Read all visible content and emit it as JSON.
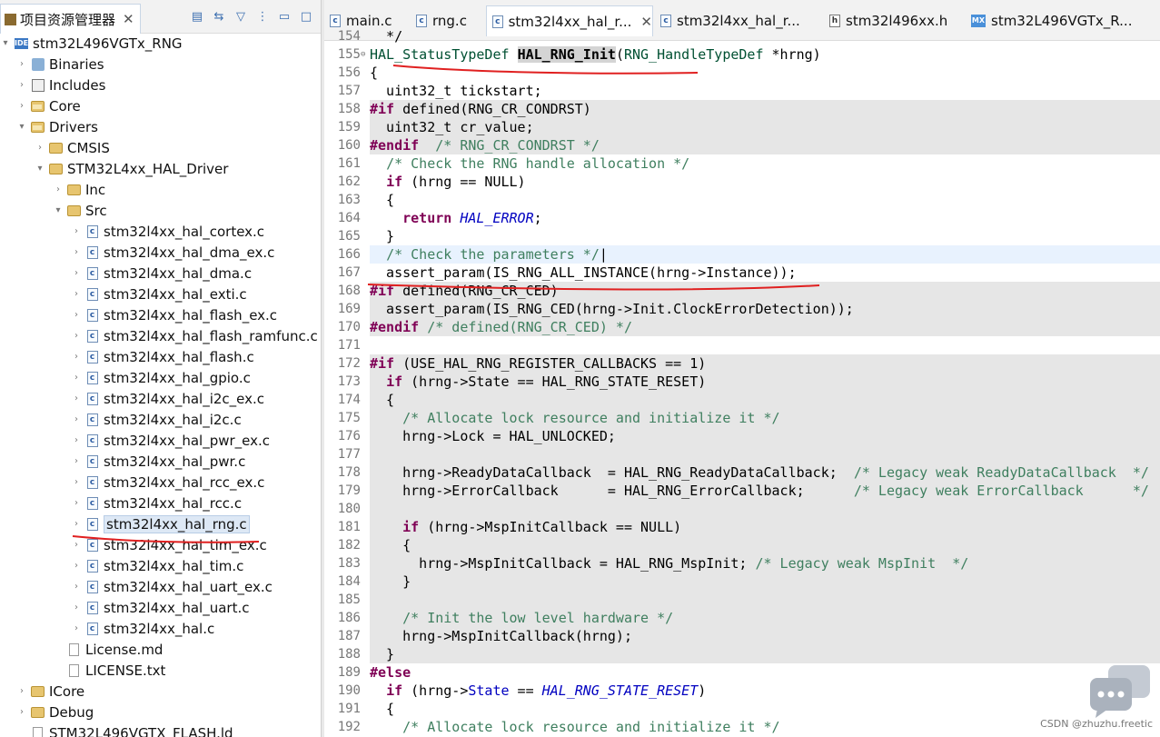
{
  "left_panel": {
    "tab_label": "项目资源管理器",
    "tab_close": "✕",
    "tree": [
      {
        "label": "stm32L496VGTx_RNG",
        "indent": 0,
        "arrow": "▾",
        "icon": "project"
      },
      {
        "label": "Binaries",
        "indent": 1,
        "arrow": "›",
        "icon": "binaries"
      },
      {
        "label": "Includes",
        "indent": 1,
        "arrow": "›",
        "icon": "includes"
      },
      {
        "label": "Core",
        "indent": 1,
        "arrow": "›",
        "icon": "src-folder"
      },
      {
        "label": "Drivers",
        "indent": 1,
        "arrow": "▾",
        "icon": "src-folder"
      },
      {
        "label": "CMSIS",
        "indent": 2,
        "arrow": "›",
        "icon": "folder"
      },
      {
        "label": "STM32L4xx_HAL_Driver",
        "indent": 2,
        "arrow": "▾",
        "icon": "folder"
      },
      {
        "label": "Inc",
        "indent": 3,
        "arrow": "›",
        "icon": "folder"
      },
      {
        "label": "Src",
        "indent": 3,
        "arrow": "▾",
        "icon": "folder"
      },
      {
        "label": "stm32l4xx_hal_cortex.c",
        "indent": 4,
        "arrow": "›",
        "icon": "c"
      },
      {
        "label": "stm32l4xx_hal_dma_ex.c",
        "indent": 4,
        "arrow": "›",
        "icon": "c"
      },
      {
        "label": "stm32l4xx_hal_dma.c",
        "indent": 4,
        "arrow": "›",
        "icon": "c"
      },
      {
        "label": "stm32l4xx_hal_exti.c",
        "indent": 4,
        "arrow": "›",
        "icon": "c"
      },
      {
        "label": "stm32l4xx_hal_flash_ex.c",
        "indent": 4,
        "arrow": "›",
        "icon": "c"
      },
      {
        "label": "stm32l4xx_hal_flash_ramfunc.c",
        "indent": 4,
        "arrow": "›",
        "icon": "c"
      },
      {
        "label": "stm32l4xx_hal_flash.c",
        "indent": 4,
        "arrow": "›",
        "icon": "c"
      },
      {
        "label": "stm32l4xx_hal_gpio.c",
        "indent": 4,
        "arrow": "›",
        "icon": "c"
      },
      {
        "label": "stm32l4xx_hal_i2c_ex.c",
        "indent": 4,
        "arrow": "›",
        "icon": "c"
      },
      {
        "label": "stm32l4xx_hal_i2c.c",
        "indent": 4,
        "arrow": "›",
        "icon": "c"
      },
      {
        "label": "stm32l4xx_hal_pwr_ex.c",
        "indent": 4,
        "arrow": "›",
        "icon": "c"
      },
      {
        "label": "stm32l4xx_hal_pwr.c",
        "indent": 4,
        "arrow": "›",
        "icon": "c"
      },
      {
        "label": "stm32l4xx_hal_rcc_ex.c",
        "indent": 4,
        "arrow": "›",
        "icon": "c"
      },
      {
        "label": "stm32l4xx_hal_rcc.c",
        "indent": 4,
        "arrow": "›",
        "icon": "c"
      },
      {
        "label": "stm32l4xx_hal_rng.c",
        "indent": 4,
        "arrow": "›",
        "icon": "c",
        "selected": true
      },
      {
        "label": "stm32l4xx_hal_tim_ex.c",
        "indent": 4,
        "arrow": "›",
        "icon": "c"
      },
      {
        "label": "stm32l4xx_hal_tim.c",
        "indent": 4,
        "arrow": "›",
        "icon": "c"
      },
      {
        "label": "stm32l4xx_hal_uart_ex.c",
        "indent": 4,
        "arrow": "›",
        "icon": "c"
      },
      {
        "label": "stm32l4xx_hal_uart.c",
        "indent": 4,
        "arrow": "›",
        "icon": "c"
      },
      {
        "label": "stm32l4xx_hal.c",
        "indent": 4,
        "arrow": "›",
        "icon": "c"
      },
      {
        "label": "License.md",
        "indent": 3,
        "arrow": "",
        "icon": "text"
      },
      {
        "label": "LICENSE.txt",
        "indent": 3,
        "arrow": "",
        "icon": "text"
      },
      {
        "label": "ICore",
        "indent": 1,
        "arrow": "›",
        "icon": "folder"
      },
      {
        "label": "Debug",
        "indent": 1,
        "arrow": "›",
        "icon": "folder"
      },
      {
        "label": "STM32L496VGTX_FLASH.ld",
        "indent": 1,
        "arrow": "",
        "icon": "text"
      }
    ]
  },
  "editor": {
    "tabs": [
      {
        "label": "main.c",
        "icon": "c"
      },
      {
        "label": "rng.c",
        "icon": "c"
      },
      {
        "label": "stm32l4xx_hal_r...",
        "icon": "c",
        "active": true
      },
      {
        "label": "stm32l4xx_hal_r...",
        "icon": "c"
      },
      {
        "label": "stm32l496xx.h",
        "icon": "h"
      },
      {
        "label": "stm32L496VGTx_R...",
        "icon": "mx"
      }
    ],
    "lines": [
      {
        "n": "154",
        "html": "  */"
      },
      {
        "n": "155",
        "fold": "⊖",
        "html": "<span class='ty'>HAL_StatusTypeDef</span> <span class='fn-hl'>HAL_RNG_Init</span>(<span class='ty'>RNG_HandleTypeDef</span> *hrng)"
      },
      {
        "n": "156",
        "html": "{"
      },
      {
        "n": "157",
        "html": "  uint32_t tickstart;"
      },
      {
        "n": "158",
        "bg": "gray",
        "html": "<span class='pp'>#if</span> defined(RNG_CR_CONDRST)"
      },
      {
        "n": "159",
        "bg": "gray",
        "html": "  uint32_t cr_value;"
      },
      {
        "n": "160",
        "bg": "gray",
        "html": "<span class='pp'>#endif</span>  <span class='cm'>/* RNG_CR_CONDRST */</span>"
      },
      {
        "n": "161",
        "html": "  <span class='cm'>/* Check the RNG handle allocation */</span>"
      },
      {
        "n": "162",
        "html": "  <span class='kw'>if</span> (hrng == NULL)"
      },
      {
        "n": "163",
        "html": "  {"
      },
      {
        "n": "164",
        "html": "    <span class='kw'>return</span> <span class='mc'>HAL_ERROR</span>;"
      },
      {
        "n": "165",
        "html": "  }"
      },
      {
        "n": "166",
        "bg": "cur",
        "html": "  <span class='cm'>/* Check the parameters */</span>|"
      },
      {
        "n": "167",
        "html": "  assert_param(IS_RNG_ALL_INSTANCE(hrng->Instance));"
      },
      {
        "n": "168",
        "bg": "gray",
        "html": "<span class='pp'>#if</span> defined(RNG_CR_CED)"
      },
      {
        "n": "169",
        "bg": "gray",
        "html": "  assert_param(IS_RNG_CED(hrng->Init.ClockErrorDetection));"
      },
      {
        "n": "170",
        "bg": "gray",
        "html": "<span class='pp'>#endif</span> <span class='cm'>/* defined(RNG_CR_CED) */</span>"
      },
      {
        "n": "171",
        "html": ""
      },
      {
        "n": "172",
        "bg": "gray",
        "html": "<span class='pp'>#if</span> (USE_HAL_RNG_REGISTER_CALLBACKS == 1)"
      },
      {
        "n": "173",
        "bg": "gray",
        "html": "  <span class='kw'>if</span> (hrng->State == HAL_RNG_STATE_RESET)"
      },
      {
        "n": "174",
        "bg": "gray",
        "html": "  {"
      },
      {
        "n": "175",
        "bg": "gray",
        "html": "    <span class='cm'>/* Allocate lock resource and initialize it */</span>"
      },
      {
        "n": "176",
        "bg": "gray",
        "html": "    hrng->Lock = HAL_UNLOCKED;"
      },
      {
        "n": "177",
        "bg": "gray",
        "html": ""
      },
      {
        "n": "178",
        "bg": "gray",
        "html": "    hrng->ReadyDataCallback  = HAL_RNG_ReadyDataCallback;  <span class='cm'>/* Legacy weak ReadyDataCallback  */</span>"
      },
      {
        "n": "179",
        "bg": "gray",
        "html": "    hrng->ErrorCallback      = HAL_RNG_ErrorCallback;      <span class='cm'>/* Legacy weak ErrorCallback      */</span>"
      },
      {
        "n": "180",
        "bg": "gray",
        "html": ""
      },
      {
        "n": "181",
        "bg": "gray",
        "html": "    <span class='kw'>if</span> (hrng->MspInitCallback == NULL)"
      },
      {
        "n": "182",
        "bg": "gray",
        "html": "    {"
      },
      {
        "n": "183",
        "bg": "gray",
        "html": "      hrng->MspInitCallback = HAL_RNG_MspInit; <span class='cm'>/* Legacy weak MspInit  */</span>"
      },
      {
        "n": "184",
        "bg": "gray",
        "html": "    }"
      },
      {
        "n": "185",
        "bg": "gray",
        "html": ""
      },
      {
        "n": "186",
        "bg": "gray",
        "html": "    <span class='cm'>/* Init the low level hardware */</span>"
      },
      {
        "n": "187",
        "bg": "gray",
        "html": "    hrng->MspInitCallback(hrng);"
      },
      {
        "n": "188",
        "bg": "gray",
        "html": "  }"
      },
      {
        "n": "189",
        "html": "<span class='pp'>#else</span>"
      },
      {
        "n": "190",
        "html": "  <span class='kw'>if</span> (hrng-><span class='fld'>State</span> == <span class='mc'>HAL_RNG_STATE_RESET</span>)"
      },
      {
        "n": "191",
        "html": "  {"
      },
      {
        "n": "192",
        "html": "    <span class='cm'>/* Allocate lock resource and initialize it */</span>"
      }
    ]
  },
  "watermark": "CSDN @zhuzhu.freetic"
}
